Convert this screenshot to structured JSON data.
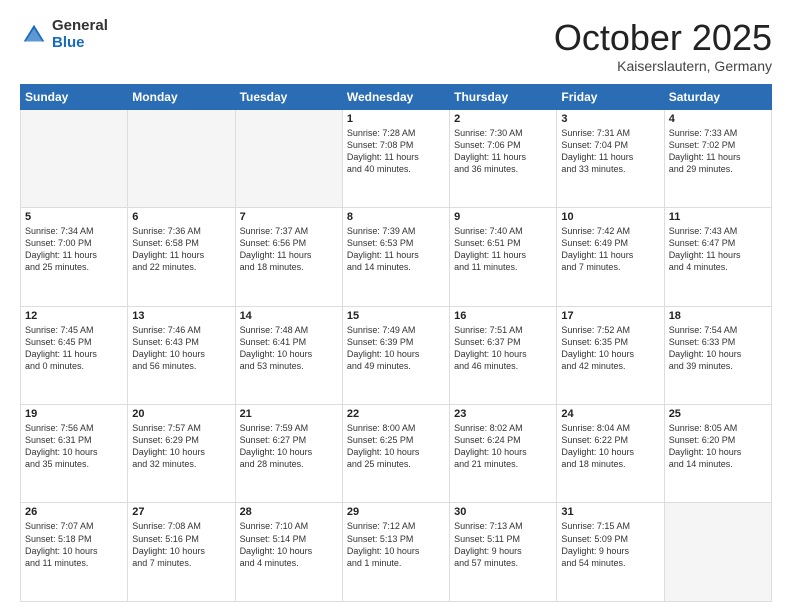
{
  "header": {
    "logo_general": "General",
    "logo_blue": "Blue",
    "month_title": "October 2025",
    "subtitle": "Kaiserslautern, Germany"
  },
  "weekdays": [
    "Sunday",
    "Monday",
    "Tuesday",
    "Wednesday",
    "Thursday",
    "Friday",
    "Saturday"
  ],
  "weeks": [
    [
      {
        "day": "",
        "info": ""
      },
      {
        "day": "",
        "info": ""
      },
      {
        "day": "",
        "info": ""
      },
      {
        "day": "1",
        "info": "Sunrise: 7:28 AM\nSunset: 7:08 PM\nDaylight: 11 hours\nand 40 minutes."
      },
      {
        "day": "2",
        "info": "Sunrise: 7:30 AM\nSunset: 7:06 PM\nDaylight: 11 hours\nand 36 minutes."
      },
      {
        "day": "3",
        "info": "Sunrise: 7:31 AM\nSunset: 7:04 PM\nDaylight: 11 hours\nand 33 minutes."
      },
      {
        "day": "4",
        "info": "Sunrise: 7:33 AM\nSunset: 7:02 PM\nDaylight: 11 hours\nand 29 minutes."
      }
    ],
    [
      {
        "day": "5",
        "info": "Sunrise: 7:34 AM\nSunset: 7:00 PM\nDaylight: 11 hours\nand 25 minutes."
      },
      {
        "day": "6",
        "info": "Sunrise: 7:36 AM\nSunset: 6:58 PM\nDaylight: 11 hours\nand 22 minutes."
      },
      {
        "day": "7",
        "info": "Sunrise: 7:37 AM\nSunset: 6:56 PM\nDaylight: 11 hours\nand 18 minutes."
      },
      {
        "day": "8",
        "info": "Sunrise: 7:39 AM\nSunset: 6:53 PM\nDaylight: 11 hours\nand 14 minutes."
      },
      {
        "day": "9",
        "info": "Sunrise: 7:40 AM\nSunset: 6:51 PM\nDaylight: 11 hours\nand 11 minutes."
      },
      {
        "day": "10",
        "info": "Sunrise: 7:42 AM\nSunset: 6:49 PM\nDaylight: 11 hours\nand 7 minutes."
      },
      {
        "day": "11",
        "info": "Sunrise: 7:43 AM\nSunset: 6:47 PM\nDaylight: 11 hours\nand 4 minutes."
      }
    ],
    [
      {
        "day": "12",
        "info": "Sunrise: 7:45 AM\nSunset: 6:45 PM\nDaylight: 11 hours\nand 0 minutes."
      },
      {
        "day": "13",
        "info": "Sunrise: 7:46 AM\nSunset: 6:43 PM\nDaylight: 10 hours\nand 56 minutes."
      },
      {
        "day": "14",
        "info": "Sunrise: 7:48 AM\nSunset: 6:41 PM\nDaylight: 10 hours\nand 53 minutes."
      },
      {
        "day": "15",
        "info": "Sunrise: 7:49 AM\nSunset: 6:39 PM\nDaylight: 10 hours\nand 49 minutes."
      },
      {
        "day": "16",
        "info": "Sunrise: 7:51 AM\nSunset: 6:37 PM\nDaylight: 10 hours\nand 46 minutes."
      },
      {
        "day": "17",
        "info": "Sunrise: 7:52 AM\nSunset: 6:35 PM\nDaylight: 10 hours\nand 42 minutes."
      },
      {
        "day": "18",
        "info": "Sunrise: 7:54 AM\nSunset: 6:33 PM\nDaylight: 10 hours\nand 39 minutes."
      }
    ],
    [
      {
        "day": "19",
        "info": "Sunrise: 7:56 AM\nSunset: 6:31 PM\nDaylight: 10 hours\nand 35 minutes."
      },
      {
        "day": "20",
        "info": "Sunrise: 7:57 AM\nSunset: 6:29 PM\nDaylight: 10 hours\nand 32 minutes."
      },
      {
        "day": "21",
        "info": "Sunrise: 7:59 AM\nSunset: 6:27 PM\nDaylight: 10 hours\nand 28 minutes."
      },
      {
        "day": "22",
        "info": "Sunrise: 8:00 AM\nSunset: 6:25 PM\nDaylight: 10 hours\nand 25 minutes."
      },
      {
        "day": "23",
        "info": "Sunrise: 8:02 AM\nSunset: 6:24 PM\nDaylight: 10 hours\nand 21 minutes."
      },
      {
        "day": "24",
        "info": "Sunrise: 8:04 AM\nSunset: 6:22 PM\nDaylight: 10 hours\nand 18 minutes."
      },
      {
        "day": "25",
        "info": "Sunrise: 8:05 AM\nSunset: 6:20 PM\nDaylight: 10 hours\nand 14 minutes."
      }
    ],
    [
      {
        "day": "26",
        "info": "Sunrise: 7:07 AM\nSunset: 5:18 PM\nDaylight: 10 hours\nand 11 minutes."
      },
      {
        "day": "27",
        "info": "Sunrise: 7:08 AM\nSunset: 5:16 PM\nDaylight: 10 hours\nand 7 minutes."
      },
      {
        "day": "28",
        "info": "Sunrise: 7:10 AM\nSunset: 5:14 PM\nDaylight: 10 hours\nand 4 minutes."
      },
      {
        "day": "29",
        "info": "Sunrise: 7:12 AM\nSunset: 5:13 PM\nDaylight: 10 hours\nand 1 minute."
      },
      {
        "day": "30",
        "info": "Sunrise: 7:13 AM\nSunset: 5:11 PM\nDaylight: 9 hours\nand 57 minutes."
      },
      {
        "day": "31",
        "info": "Sunrise: 7:15 AM\nSunset: 5:09 PM\nDaylight: 9 hours\nand 54 minutes."
      },
      {
        "day": "",
        "info": ""
      }
    ]
  ]
}
